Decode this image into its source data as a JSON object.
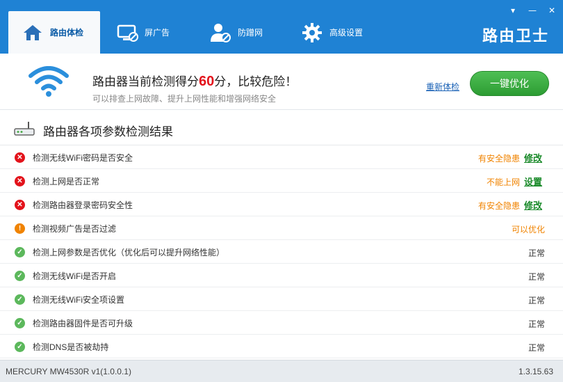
{
  "header": {
    "tabs": [
      {
        "label": "路由体检",
        "icon": "home-icon"
      },
      {
        "label": "屏广告",
        "icon": "monitor-block-icon"
      },
      {
        "label": "防蹭网",
        "icon": "user-block-icon"
      },
      {
        "label": "高级设置",
        "icon": "gear-icon"
      }
    ],
    "brand": "路由卫士",
    "window_controls": {
      "menu": "▾",
      "minimize": "—",
      "close": "✕"
    }
  },
  "summary": {
    "score_prefix": "路由器当前检测得分",
    "score": "60",
    "score_suffix": "分，比较危险！",
    "subtitle": "可以排查上网故障、提升上网性能和增强网络安全",
    "recheck_label": "重新体检",
    "optimize_label": "一键优化"
  },
  "results": {
    "title": "路由器各项参数检测结果",
    "rows": [
      {
        "label": "检测无线WiFi密码是否安全",
        "status": "error",
        "result": "有安全隐患",
        "action": "修改"
      },
      {
        "label": "检测上网是否正常",
        "status": "error",
        "result": "不能上网",
        "action": "设置"
      },
      {
        "label": "检测路由器登录密码安全性",
        "status": "error",
        "result": "有安全隐患",
        "action": "修改"
      },
      {
        "label": "检测视频广告是否过滤",
        "status": "warning",
        "result": "可以优化",
        "action": ""
      },
      {
        "label": "检测上网参数是否优化（优化后可以提升网络性能）",
        "status": "ok",
        "result": "正常",
        "action": ""
      },
      {
        "label": "检测无线WiFi是否开启",
        "status": "ok",
        "result": "正常",
        "action": ""
      },
      {
        "label": "检测无线WiFi安全项设置",
        "status": "ok",
        "result": "正常",
        "action": ""
      },
      {
        "label": "检测路由器固件是否可升级",
        "status": "ok",
        "result": "正常",
        "action": ""
      },
      {
        "label": "检测DNS是否被劫持",
        "status": "ok",
        "result": "正常",
        "action": ""
      }
    ]
  },
  "footer": {
    "model": "MERCURY MW4530R v1(1.0.0.1)",
    "version": "1.3.15.63"
  },
  "colors": {
    "header_bg": "#1f82d4",
    "danger": "#e3131b",
    "warning": "#f08300",
    "ok": "#5cb85c",
    "action_green": "#1a8a2a"
  }
}
